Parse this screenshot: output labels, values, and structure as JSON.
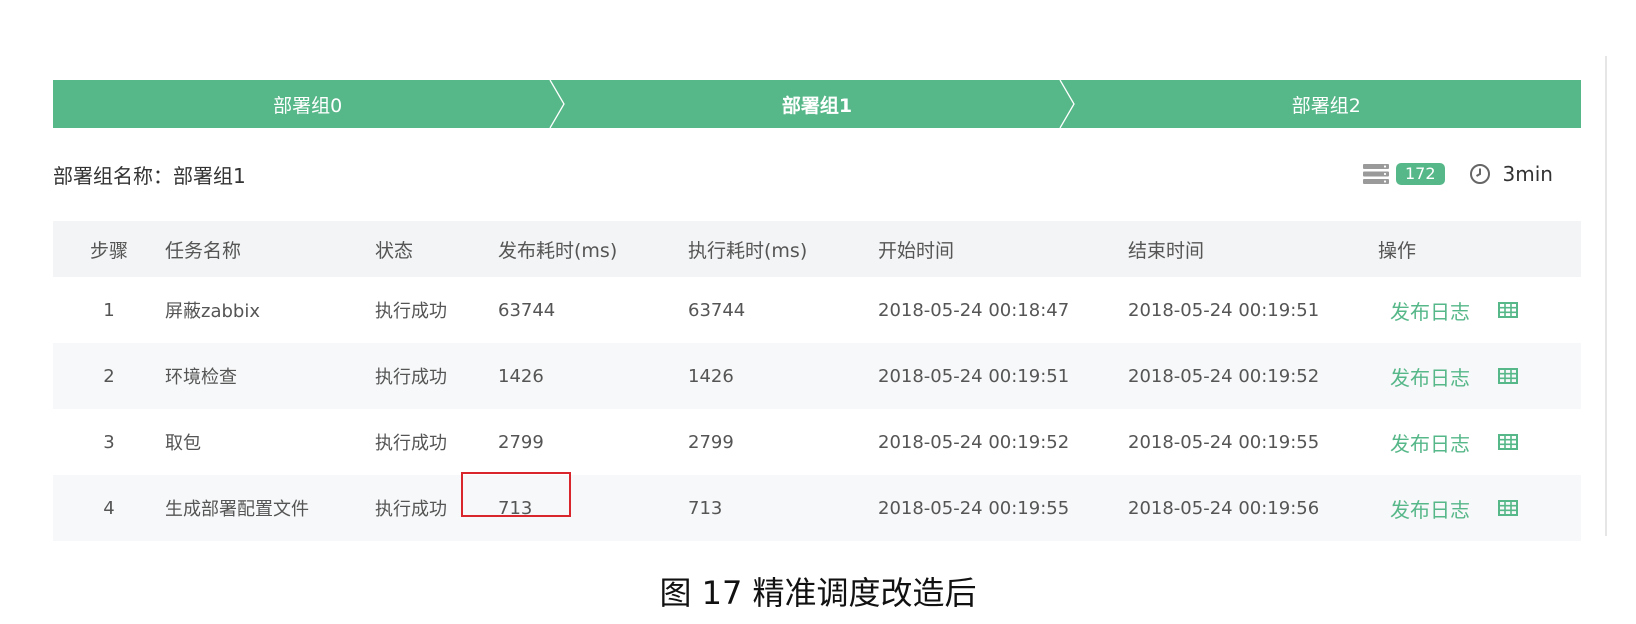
{
  "steps": [
    {
      "label": "部署组0",
      "active": false
    },
    {
      "label": "部署组1",
      "active": true
    },
    {
      "label": "部署组2",
      "active": false
    }
  ],
  "group": {
    "name_label": "部署组名称：部署组1",
    "count": "172",
    "duration": "3min",
    "server_icon": "server-stack-icon",
    "clock_icon": "clock-icon"
  },
  "table": {
    "headers": [
      "步骤",
      "任务名称",
      "状态",
      "发布耗时(ms)",
      "执行耗时(ms)",
      "开始时间",
      "结束时间",
      "操作"
    ],
    "rows": [
      {
        "step": "1",
        "name": "屏蔽zabbix",
        "status": "执行成功",
        "publish_ms": "63744",
        "exec_ms": "63744",
        "start": "2018-05-24 00:18:47",
        "end": "2018-05-24 00:19:51",
        "action": "发布日志"
      },
      {
        "step": "2",
        "name": "环境检查",
        "status": "执行成功",
        "publish_ms": "1426",
        "exec_ms": "1426",
        "start": "2018-05-24 00:19:51",
        "end": "2018-05-24 00:19:52",
        "action": "发布日志"
      },
      {
        "step": "3",
        "name": "取包",
        "status": "执行成功",
        "publish_ms": "2799",
        "exec_ms": "2799",
        "start": "2018-05-24 00:19:52",
        "end": "2018-05-24 00:19:55",
        "action": "发布日志"
      },
      {
        "step": "4",
        "name": "生成部署配置文件",
        "status": "执行成功",
        "publish_ms": "713",
        "exec_ms": "713",
        "start": "2018-05-24 00:19:55",
        "end": "2018-05-24 00:19:56",
        "action": "发布日志"
      }
    ]
  },
  "caption": "图 17  精准调度改造后",
  "colors": {
    "accent": "#56b789",
    "highlight": "#d9262c"
  }
}
